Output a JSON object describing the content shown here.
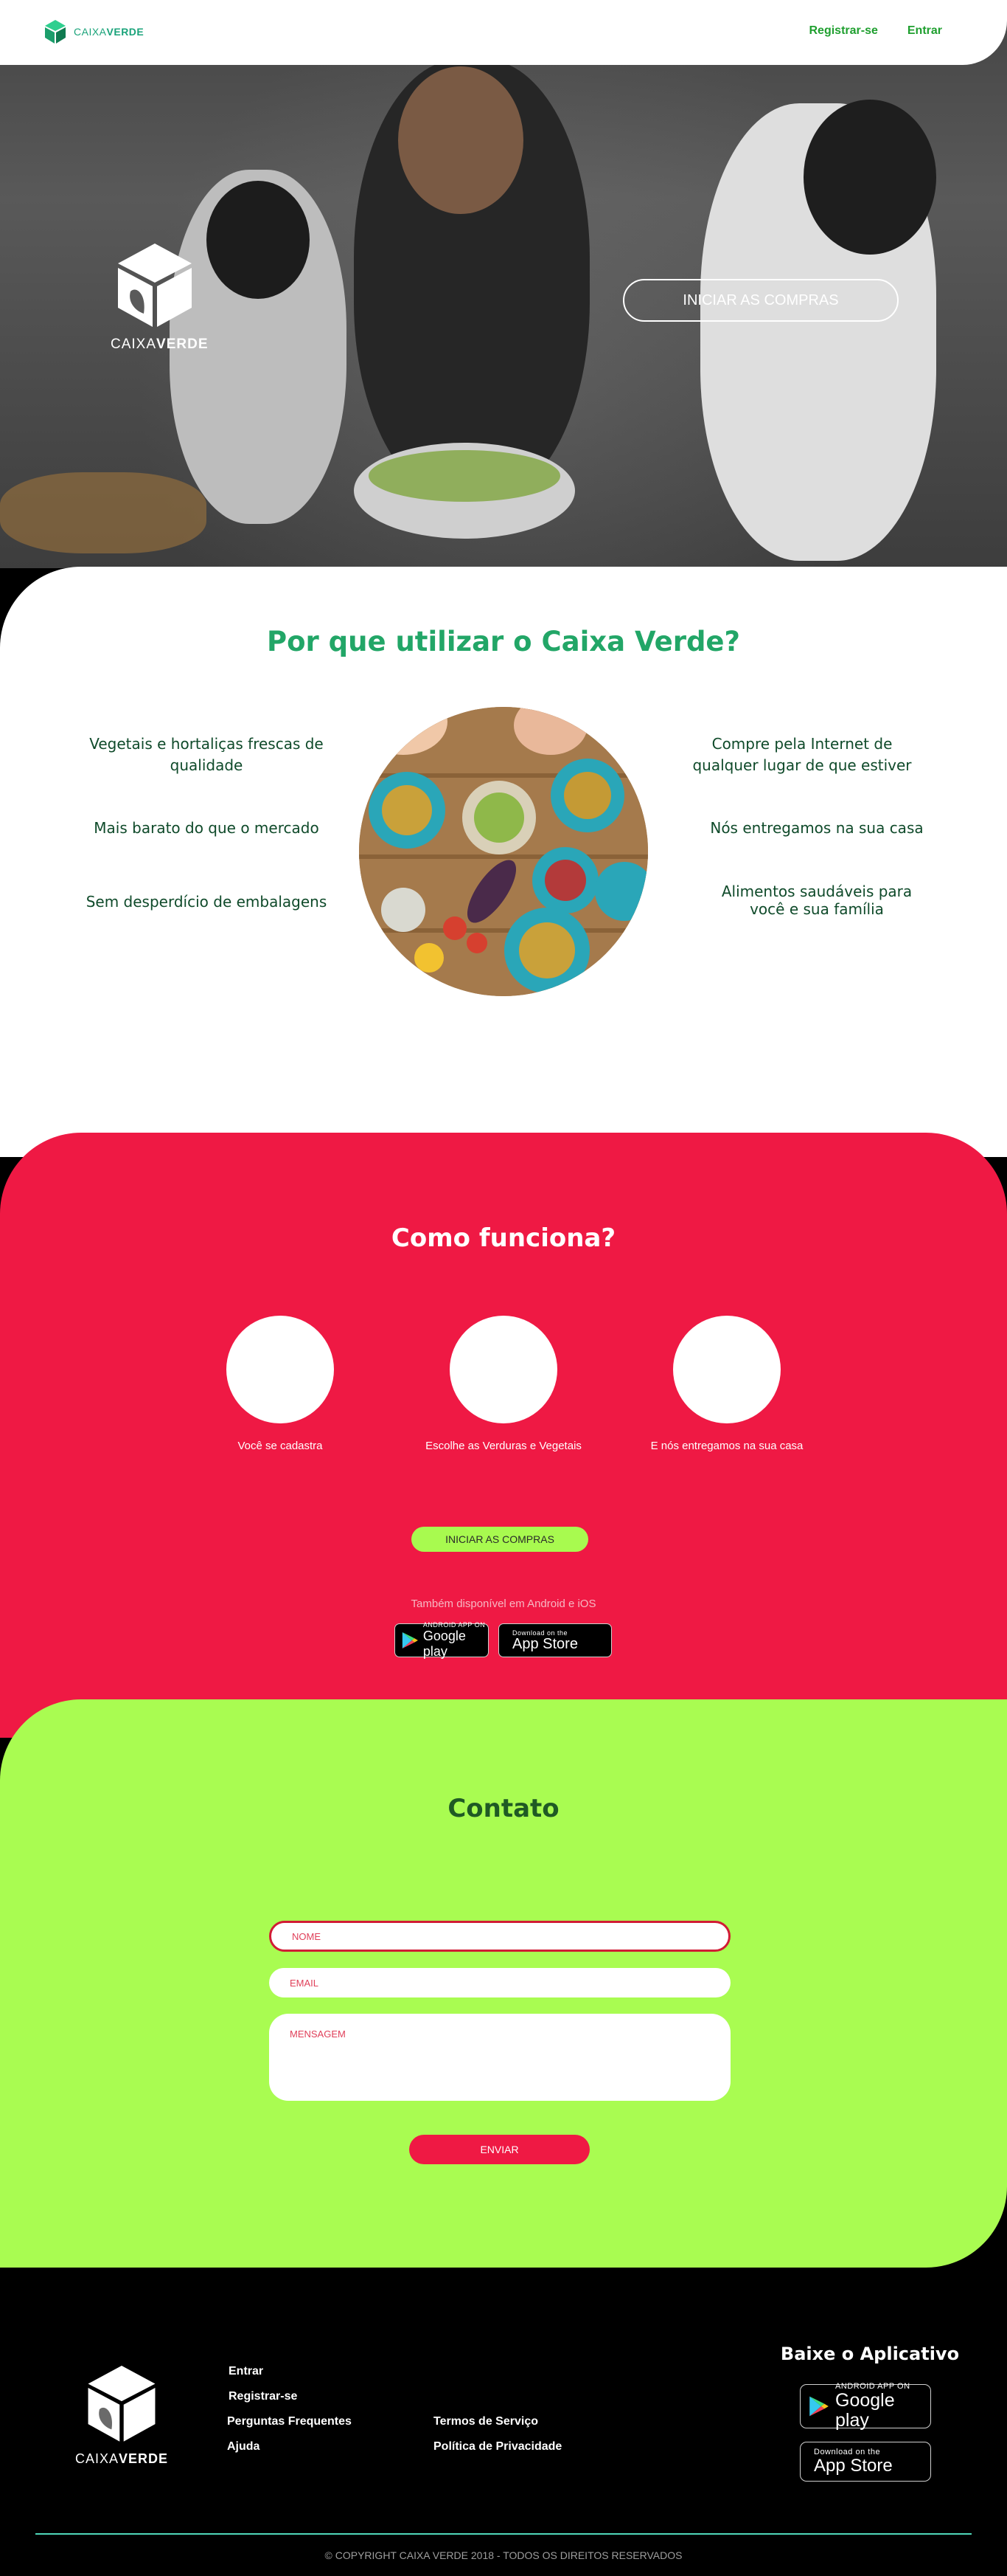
{
  "nav": {
    "brand_light": "CAIXA",
    "brand_bold": "VERDE",
    "register": "Registrar-se",
    "login": "Entrar"
  },
  "hero": {
    "brand_light": "CAIXA",
    "brand_bold": "VERDE",
    "cta": "INICIAR AS COMPRAS"
  },
  "why": {
    "title": "Por que utilizar o Caixa Verde?",
    "left": [
      "Vegetais e hortaliças frescas de qualidade",
      "Mais barato do que o mercado",
      "Sem desperdício de embalagens"
    ],
    "right": [
      "Compre pela Internet de qualquer lugar de que estiver",
      "Nós entregamos na sua casa",
      "Alimentos saudáveis para você e sua família"
    ]
  },
  "how": {
    "title": "Como funciona?",
    "steps": [
      "Você se cadastra",
      "Escolhe as Verduras e Vegetais",
      "E nós entregamos na sua casa"
    ],
    "cta": "INICIAR AS COMPRAS",
    "available": "Também disponível em Android e iOS"
  },
  "stores": {
    "google_small": "ANDROID APP ON",
    "google_big": "Google play",
    "apple_small": "Download on the",
    "apple_big": "App Store"
  },
  "contact": {
    "title": "Contato",
    "name_placeholder": "NOME",
    "email_placeholder": "EMAIL",
    "message_placeholder": "MENSAGEM",
    "send": "ENVIAR"
  },
  "footer": {
    "brand_light": "CAIXA",
    "brand_bold": "VERDE",
    "links_col1": [
      "Entrar",
      "Registrar-se",
      "Perguntas Frequentes",
      "Ajuda"
    ],
    "links_col2": [
      "Termos de Serviço",
      "Política de Privacidade"
    ],
    "app_title": "Baixe o Aplicativo",
    "copyright": "© COPYRIGHT CAIXA VERDE 2018 - TODOS OS DIREITOS RESERVADOS"
  },
  "colors": {
    "green_text": "#22a667",
    "red": "#ef1944",
    "lime": "#a9fc51",
    "footer_line": "#4fd6b9"
  },
  "icons": [
    "cube-logo-icon",
    "google-play-icon",
    "apple-icon"
  ]
}
